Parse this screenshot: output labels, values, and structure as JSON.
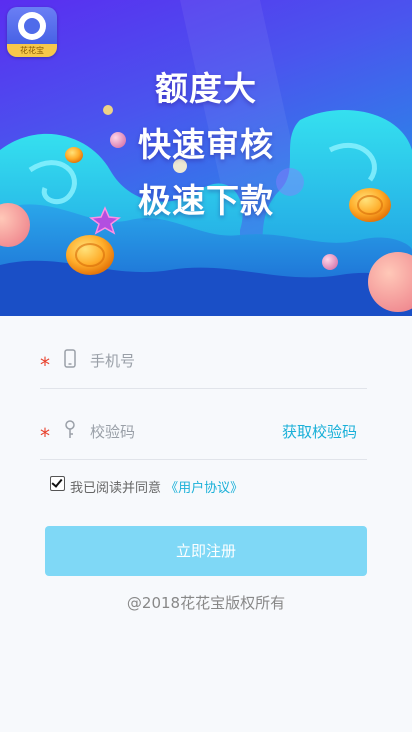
{
  "app": {
    "logo_label": "花花宝",
    "logo_icon": "diamond-coin-icon"
  },
  "banner": {
    "line1": "额度大",
    "line2": "快速审核",
    "line3": "极速下款"
  },
  "form": {
    "phone": {
      "placeholder": "手机号",
      "icon": "phone-icon",
      "required_mark": "*"
    },
    "code": {
      "placeholder": "校验码",
      "icon": "key-icon",
      "required_mark": "*",
      "get_code_label": "获取校验码"
    },
    "agreement": {
      "checked": true,
      "text": "我已阅读并同意",
      "link": "《用户协议》"
    },
    "submit_label": "立即注册"
  },
  "footer": {
    "copyright": "@2018花花宝版权所有"
  },
  "colors": {
    "accent": "#1ab0d8",
    "button": "#7fd8f6",
    "required": "#e8412c"
  }
}
